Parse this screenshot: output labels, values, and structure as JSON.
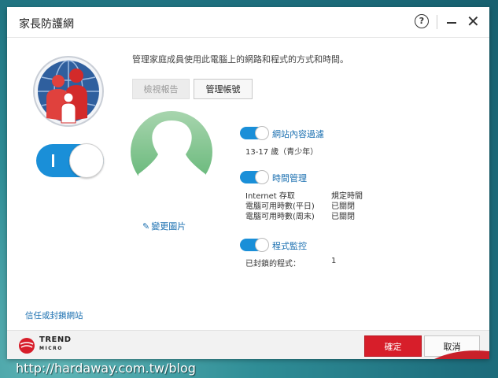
{
  "window": {
    "title": "家長防護網"
  },
  "description": "管理家庭成員使用此電腦上的網路和程式的方式和時間。",
  "buttons": {
    "view_report": "檢視報告",
    "manage_account": "管理帳號",
    "ok": "確定",
    "cancel": "取消"
  },
  "main_toggle": {
    "on": true,
    "glyph": "I"
  },
  "change_photo": "變更圖片",
  "sections": {
    "web_filter": {
      "label": "網站內容過濾",
      "on": true,
      "value": "13-17 歲（青少年）"
    },
    "time": {
      "label": "時間管理",
      "on": true,
      "rows": [
        {
          "key": "Internet 存取",
          "value": "規定時間"
        },
        {
          "key": "電腦可用時數(平日)",
          "value": "已關閉"
        },
        {
          "key": "電腦可用時數(周末)",
          "value": "已關閉"
        }
      ]
    },
    "program": {
      "label": "程式監控",
      "on": true,
      "key": "已封鎖的程式：",
      "value": "1"
    }
  },
  "trust_link": "信任或封鎖網站",
  "brand": {
    "name": "TREND",
    "sub": "MICRO"
  },
  "watermark": "http://hardaway.com.tw/blog",
  "colors": {
    "accent": "#1a8fd8",
    "link": "#1a6fb0",
    "confirm": "#d71e2a"
  },
  "icons": {
    "help": "help-icon",
    "minimize": "minimize-icon",
    "close": "close-icon",
    "edit": "pencil-icon"
  }
}
